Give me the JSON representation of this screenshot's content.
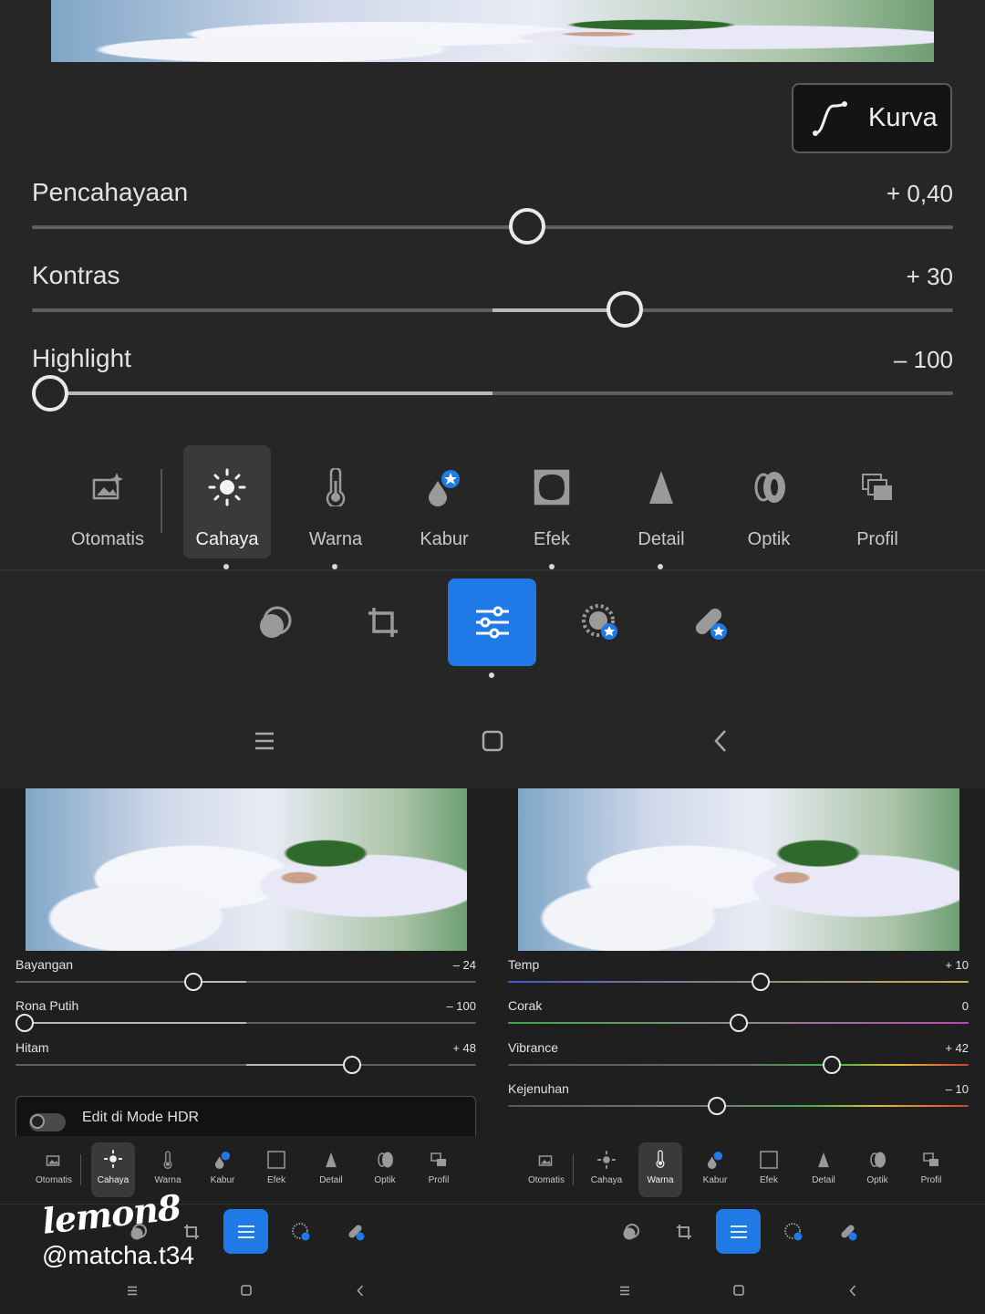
{
  "top": {
    "curve_button": {
      "label": "Kurva"
    },
    "sliders": [
      {
        "label": "Pencahayaan",
        "value": "+ 0,40",
        "position": 0.54
      },
      {
        "label": "Kontras",
        "value": "+ 30",
        "position": 0.65
      },
      {
        "label": "Highlight",
        "value": "– 100",
        "position": 0.0
      }
    ],
    "tools": [
      {
        "label": "Otomatis",
        "icon": "auto-photo-icon"
      },
      {
        "label": "Cahaya",
        "icon": "sun-icon"
      },
      {
        "label": "Warna",
        "icon": "thermometer-icon"
      },
      {
        "label": "Kabur",
        "icon": "drops-premium-icon"
      },
      {
        "label": "Efek",
        "icon": "vignette-icon"
      },
      {
        "label": "Detail",
        "icon": "triangle-icon"
      },
      {
        "label": "Optik",
        "icon": "lens-icon"
      },
      {
        "label": "Profil",
        "icon": "profile-stack-icon"
      }
    ],
    "active_tool": "Cahaya"
  },
  "left_panel": {
    "sliders": [
      {
        "label": "Bayangan",
        "value": "– 24",
        "position": 0.38
      },
      {
        "label": "Rona Putih",
        "value": "– 100",
        "position": 0.0
      },
      {
        "label": "Hitam",
        "value": "+ 48",
        "position": 0.74
      }
    ],
    "hdr_toggle": {
      "label": "Edit di Mode HDR",
      "on": false
    },
    "active_tool": "Cahaya"
  },
  "right_panel": {
    "sliders": [
      {
        "label": "Temp",
        "value": "+ 10",
        "position": 0.55
      },
      {
        "label": "Corak",
        "value": "0",
        "position": 0.5
      },
      {
        "label": "Vibrance",
        "value": "+ 42",
        "position": 0.71
      },
      {
        "label": "Kejenuhan",
        "value": "– 10",
        "position": 0.45
      }
    ],
    "active_tool": "Warna"
  },
  "watermark": {
    "logo": "lemon8",
    "handle": "@matcha.t34"
  },
  "colors": {
    "accent": "#1f7ae8",
    "panel": "#262626",
    "track": "#5f5f5f"
  }
}
